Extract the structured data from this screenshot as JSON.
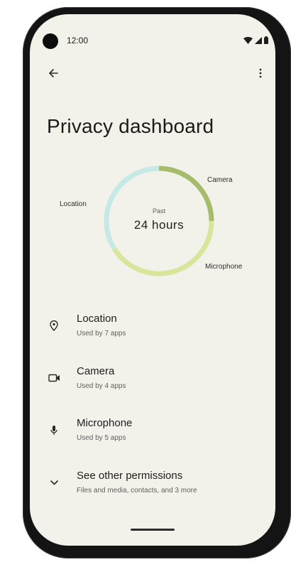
{
  "status_bar": {
    "time": "12:00",
    "icons": [
      "wifi-icon",
      "signal-icon",
      "battery-icon"
    ]
  },
  "app_bar": {
    "back_icon": "arrow-back-icon",
    "more_icon": "more-vert-icon"
  },
  "page": {
    "title": "Privacy dashboard"
  },
  "usage_chart": {
    "center_top": "Past",
    "center_main": "24  hours",
    "segments": [
      {
        "label": "Camera",
        "color": "#a5bc6b"
      },
      {
        "label": "Microphone",
        "color": "#d7e69b"
      },
      {
        "label": "Location",
        "color": "#c5e9e6"
      }
    ]
  },
  "permissions": [
    {
      "title": "Location",
      "subtitle": "Used by 7 apps",
      "icon": "location-pin-icon"
    },
    {
      "title": "Camera",
      "subtitle": "Used by 4 apps",
      "icon": "videocam-icon"
    },
    {
      "title": "Microphone",
      "subtitle": "Used by 5 apps",
      "icon": "mic-icon"
    },
    {
      "title": "See other permissions",
      "subtitle": "Files and media, contacts, and 3 more",
      "icon": "chevron-down-icon"
    }
  ],
  "colors": {
    "screen_background": "#f2f1ea",
    "frame": "#141414",
    "camera_arc": "#a5bc6b",
    "microphone_arc": "#d7e69b",
    "location_arc": "#c5e9e6"
  }
}
